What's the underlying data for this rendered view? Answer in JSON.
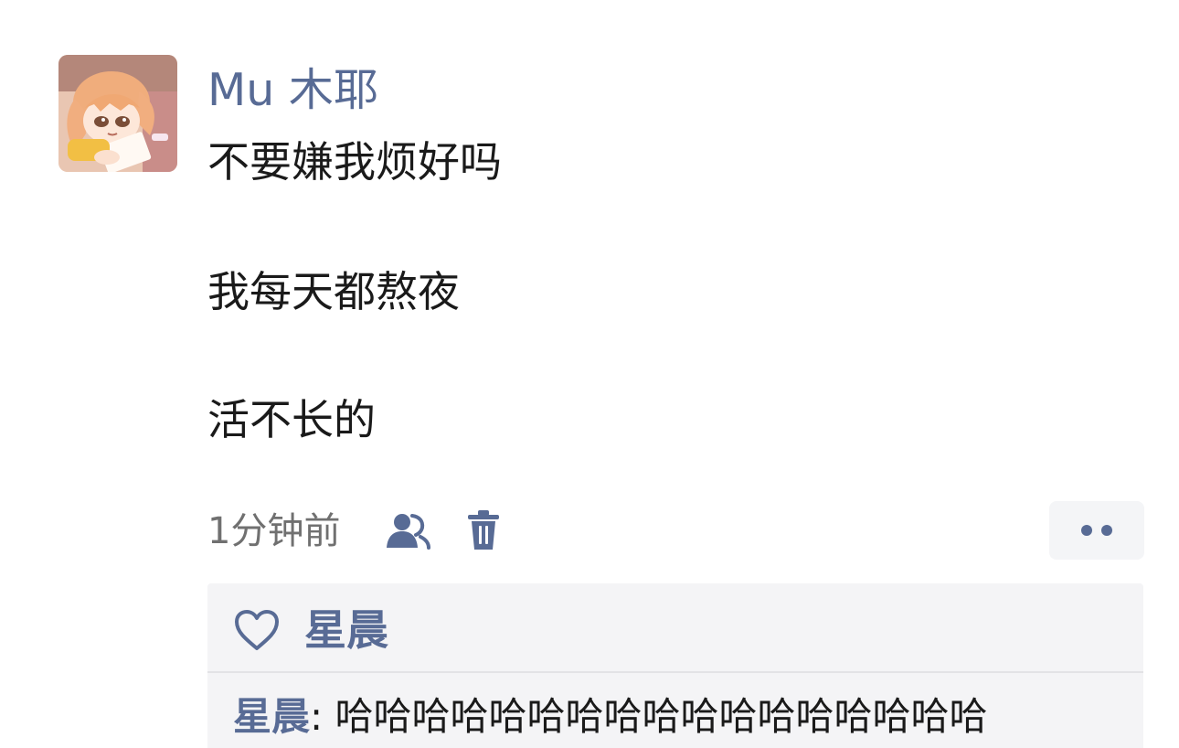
{
  "post": {
    "author": "Mu 木耶",
    "avatar_icon": "anime-girl-avatar",
    "lines": [
      "不要嫌我烦好吗",
      "我每天都熬夜",
      "活不长的"
    ],
    "timestamp": "1分钟前",
    "visibility_icon": "people-icon",
    "delete_icon": "trash-icon",
    "more_icon": "more-dots-icon"
  },
  "likes": {
    "icon": "heart-icon",
    "names": "星晨"
  },
  "comments": [
    {
      "author": "星晨",
      "separator": ":",
      "text": "哈哈哈哈哈哈哈哈哈哈哈哈哈哈哈哈哈"
    }
  ],
  "colors": {
    "accent": "#586b95",
    "panel_bg": "#f4f4f6",
    "text": "#1a1a1a",
    "meta_text": "#707070"
  }
}
